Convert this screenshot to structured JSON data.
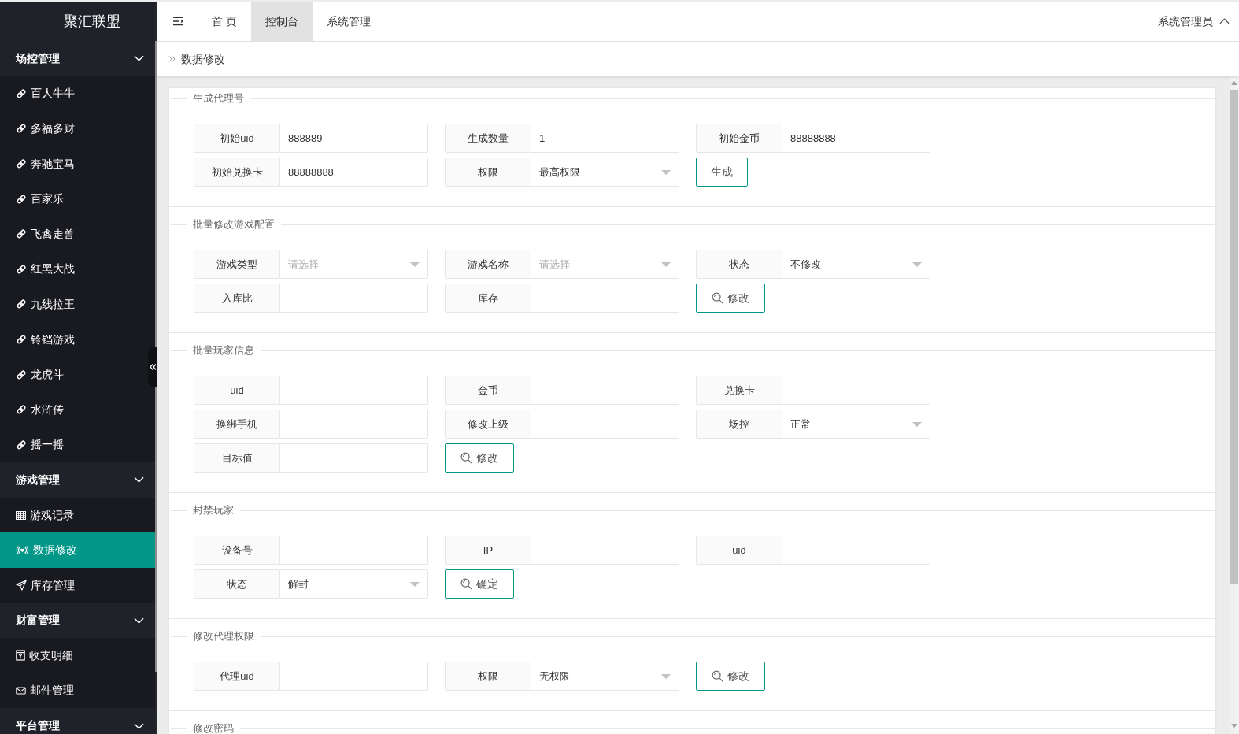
{
  "sidebar": {
    "logo": "聚汇联盟",
    "groups": [
      {
        "title": "场控管理",
        "expanded": true,
        "items": [
          {
            "label": "百人牛牛",
            "kind": "link",
            "selected": false
          },
          {
            "label": "多福多财",
            "kind": "link",
            "selected": false
          },
          {
            "label": "奔驰宝马",
            "kind": "link",
            "selected": false
          },
          {
            "label": "百家乐",
            "kind": "link",
            "selected": false
          },
          {
            "label": "飞禽走兽",
            "kind": "link",
            "selected": false
          },
          {
            "label": "红黑大战",
            "kind": "link",
            "selected": false
          },
          {
            "label": "九线拉王",
            "kind": "link",
            "selected": false
          },
          {
            "label": "铃铛游戏",
            "kind": "link",
            "selected": false
          },
          {
            "label": "龙虎斗",
            "kind": "link",
            "selected": false
          },
          {
            "label": "水浒传",
            "kind": "link",
            "selected": false
          },
          {
            "label": "摇一摇",
            "kind": "link",
            "selected": false
          }
        ]
      },
      {
        "title": "游戏管理",
        "expanded": true,
        "items": [
          {
            "label": "游戏记录",
            "kind": "table",
            "selected": false
          },
          {
            "label": "数据修改",
            "kind": "broadcast",
            "selected": true
          },
          {
            "label": "库存管理",
            "kind": "send",
            "selected": false
          }
        ]
      },
      {
        "title": "财富管理",
        "expanded": true,
        "items": [
          {
            "label": "收支明细",
            "kind": "document",
            "selected": false
          },
          {
            "label": "邮件管理",
            "kind": "mail",
            "selected": false
          }
        ]
      },
      {
        "title": "平台管理",
        "expanded": true
      }
    ]
  },
  "header": {
    "tabs": [
      {
        "label": "首 页",
        "selected": false
      },
      {
        "label": "控制台",
        "selected": true
      },
      {
        "label": "系统管理",
        "selected": false
      }
    ],
    "user": "系统管理员"
  },
  "breadcrumb": "数据修改",
  "sections": [
    {
      "title": "生成代理号",
      "fields": [
        {
          "kind": "input",
          "label": "初始uid",
          "value": "888889"
        },
        {
          "kind": "input",
          "label": "生成数量",
          "value": "1"
        },
        {
          "kind": "input",
          "label": "初始金币",
          "value": "88888888"
        },
        {
          "kind": "input",
          "label": "初始兑换卡",
          "value": "88888888"
        },
        {
          "kind": "select",
          "label": "权限",
          "value": "最高权限"
        },
        {
          "kind": "button",
          "text": "生成"
        }
      ]
    },
    {
      "title": "批量修改游戏配置",
      "fields": [
        {
          "kind": "select",
          "label": "游戏类型",
          "placeholder": "请选择"
        },
        {
          "kind": "select",
          "label": "游戏名称",
          "placeholder": "请选择"
        },
        {
          "kind": "select",
          "label": "状态",
          "value": "不修改"
        },
        {
          "kind": "input",
          "label": "入库比"
        },
        {
          "kind": "input",
          "label": "库存"
        },
        {
          "kind": "search_button",
          "text": "修改"
        }
      ]
    },
    {
      "title": "批量玩家信息",
      "fields": [
        {
          "kind": "input",
          "label": "uid"
        },
        {
          "kind": "input",
          "label": "金币"
        },
        {
          "kind": "input",
          "label": "兑换卡"
        },
        {
          "kind": "input",
          "label": "换绑手机"
        },
        {
          "kind": "input",
          "label": "修改上级"
        },
        {
          "kind": "select",
          "label": "场控",
          "value": "正常"
        },
        {
          "kind": "input",
          "label": "目标值"
        },
        {
          "kind": "search_button",
          "text": "修改"
        }
      ]
    },
    {
      "title": "封禁玩家",
      "fields": [
        {
          "kind": "input",
          "label": "设备号"
        },
        {
          "kind": "input",
          "label": "IP"
        },
        {
          "kind": "input",
          "label": "uid"
        },
        {
          "kind": "select",
          "label": "状态",
          "value": "解封"
        },
        {
          "kind": "search_button",
          "text": "确定"
        }
      ]
    },
    {
      "title": "修改代理权限",
      "fields": [
        {
          "kind": "input",
          "label": "代理uid"
        },
        {
          "kind": "select",
          "label": "权限",
          "value": "无权限"
        },
        {
          "kind": "search_button",
          "text": "修改"
        }
      ]
    },
    {
      "title": "修改密码"
    }
  ]
}
